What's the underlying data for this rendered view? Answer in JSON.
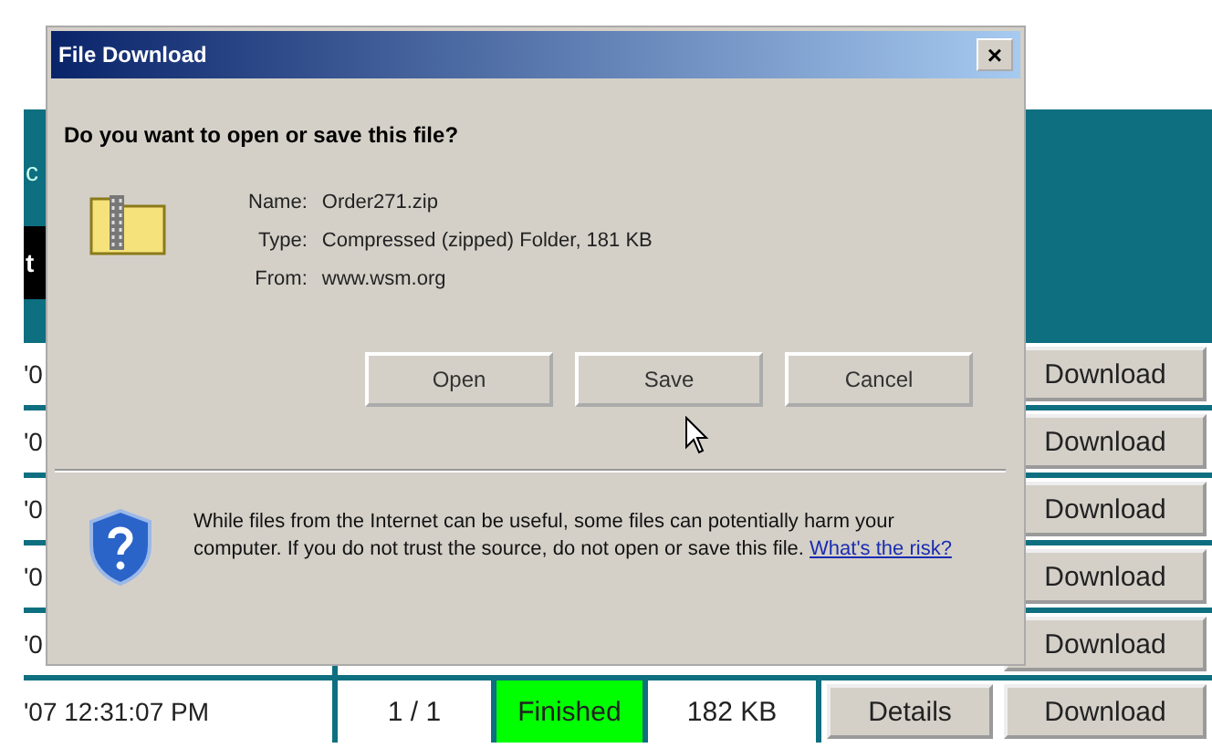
{
  "page": {
    "header_text": "c",
    "band_text": "t",
    "rows": [
      {
        "date": "'0",
        "action": "Download"
      },
      {
        "date": "'0",
        "action": "Download"
      },
      {
        "date": "'0",
        "action": "Download"
      },
      {
        "date": "'0",
        "action": "Download"
      },
      {
        "date": "'0",
        "action": "Download"
      },
      {
        "date": "'07 12:31:07 PM",
        "pages": "1 / 1",
        "status": "Finished",
        "size": "182 KB",
        "details": "Details",
        "action": "Download"
      }
    ]
  },
  "dialog": {
    "title": "File Download",
    "close": "×",
    "question": "Do you want to open or save this file?",
    "fields": [
      {
        "label": "Name:",
        "value": "Order271.zip"
      },
      {
        "label": "Type:",
        "value": "Compressed (zipped) Folder, 181 KB"
      },
      {
        "label": "From:",
        "value": "www.wsm.org"
      }
    ],
    "buttons": [
      {
        "label": "Open"
      },
      {
        "label": "Save"
      },
      {
        "label": "Cancel"
      }
    ],
    "warning": "While files from the Internet can be useful, some files can potentially harm your computer. If you do not trust the source, do not open or save this file.",
    "link": "What's the risk?"
  }
}
